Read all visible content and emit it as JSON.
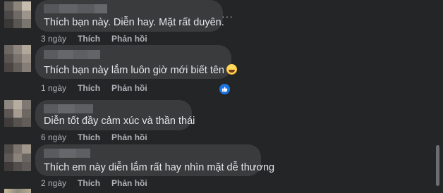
{
  "comments": [
    {
      "text": "Thích bạn này. Diễn hay. Mặt rất duyên.",
      "time": "3 ngày",
      "like_label": "Thích",
      "reply_label": "Phản hồi",
      "more": "···"
    },
    {
      "text": "Thích bạn này lắm luôn giờ mới biết tên",
      "time": "1 ngày",
      "like_label": "Thích",
      "reply_label": "Phản hồi",
      "emoji": "laughing-emoji",
      "reaction": "like-reaction"
    },
    {
      "text": "Diễn tốt đầy cảm xúc và thần thái",
      "time": "6 ngày",
      "like_label": "Thích",
      "reply_label": "Phản hồi"
    },
    {
      "text": "Thích em này diễn lắm rất hay nhìn mặt dễ thương",
      "time": "2 ngày",
      "like_label": "Thích",
      "reply_label": "Phản hồi"
    }
  ],
  "colors": {
    "background": "#242526",
    "bubble": "#3a3b3c",
    "text": "#e4e6eb",
    "secondary": "#b0b3b8",
    "like_blue": "#1b74e4"
  }
}
